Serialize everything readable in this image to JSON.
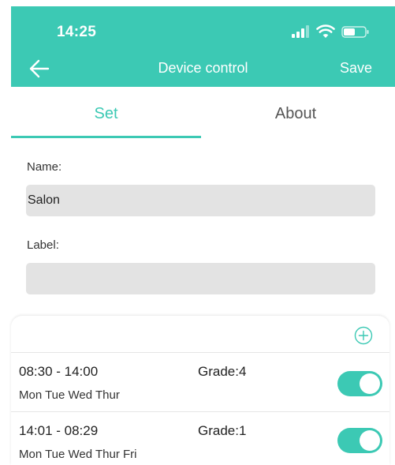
{
  "status_bar": {
    "time": "14:25"
  },
  "nav": {
    "title": "Device control",
    "save_label": "Save"
  },
  "tabs": [
    {
      "label": "Set",
      "active": true
    },
    {
      "label": "About",
      "active": false
    }
  ],
  "form": {
    "name_label": "Name:",
    "name_value": "Salon",
    "label_label": "Label:",
    "label_value": ""
  },
  "schedules": [
    {
      "time": "08:30 - 14:00",
      "days": "Mon Tue Wed Thur",
      "grade": "Grade:4",
      "enabled": true
    },
    {
      "time": "14:01 - 08:29",
      "days": "Mon Tue Wed Thur Fri",
      "grade": "Grade:1",
      "enabled": true
    }
  ],
  "colors": {
    "accent": "#3cc9b4",
    "input_bg": "#e3e3e3"
  },
  "icons": {
    "back": "arrow-left-icon",
    "add": "plus-circle-icon",
    "signal": "signal-icon",
    "wifi": "wifi-icon",
    "battery": "battery-icon"
  }
}
